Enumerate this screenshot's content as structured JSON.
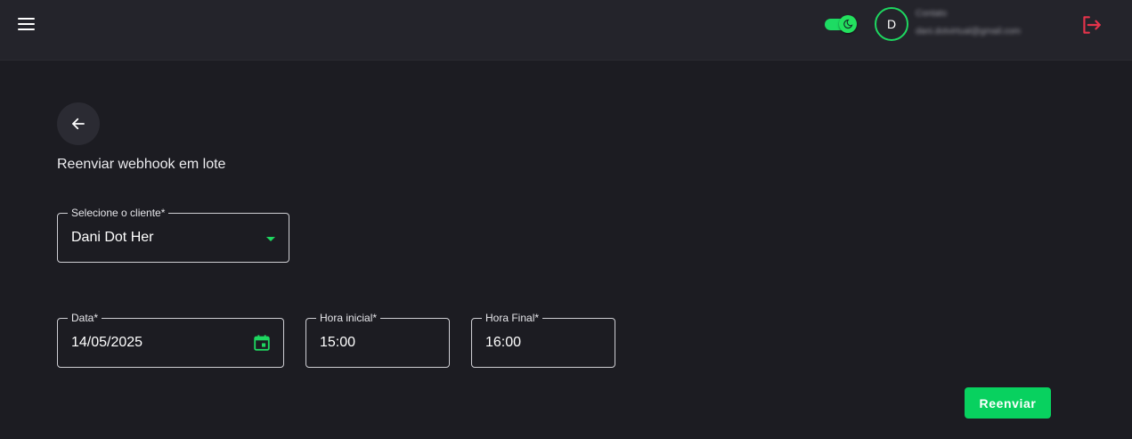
{
  "header": {
    "user": {
      "avatar_initial": "D",
      "name": "Contato",
      "email": "dani.dotvirtual@gmail.com"
    }
  },
  "page": {
    "title": "Reenviar webhook em lote"
  },
  "form": {
    "client": {
      "label": "Selecione o cliente*",
      "value": "Dani Dot Her"
    },
    "date": {
      "label": "Data*",
      "value": "14/05/2025"
    },
    "start_time": {
      "label": "Hora inicial*",
      "value": "15:00"
    },
    "end_time": {
      "label": "Hora Final*",
      "value": "16:00"
    },
    "submit_label": "Reenviar"
  },
  "icons": {
    "menu": "menu-icon",
    "theme": "moon-icon",
    "logout": "logout-icon",
    "back": "arrow-left-icon",
    "calendar": "calendar-icon",
    "dropdown": "chevron-down-icon"
  },
  "colors": {
    "accent": "#08d15f",
    "logout": "#e5334b",
    "background": "#1c1c22",
    "header": "#24242b"
  }
}
